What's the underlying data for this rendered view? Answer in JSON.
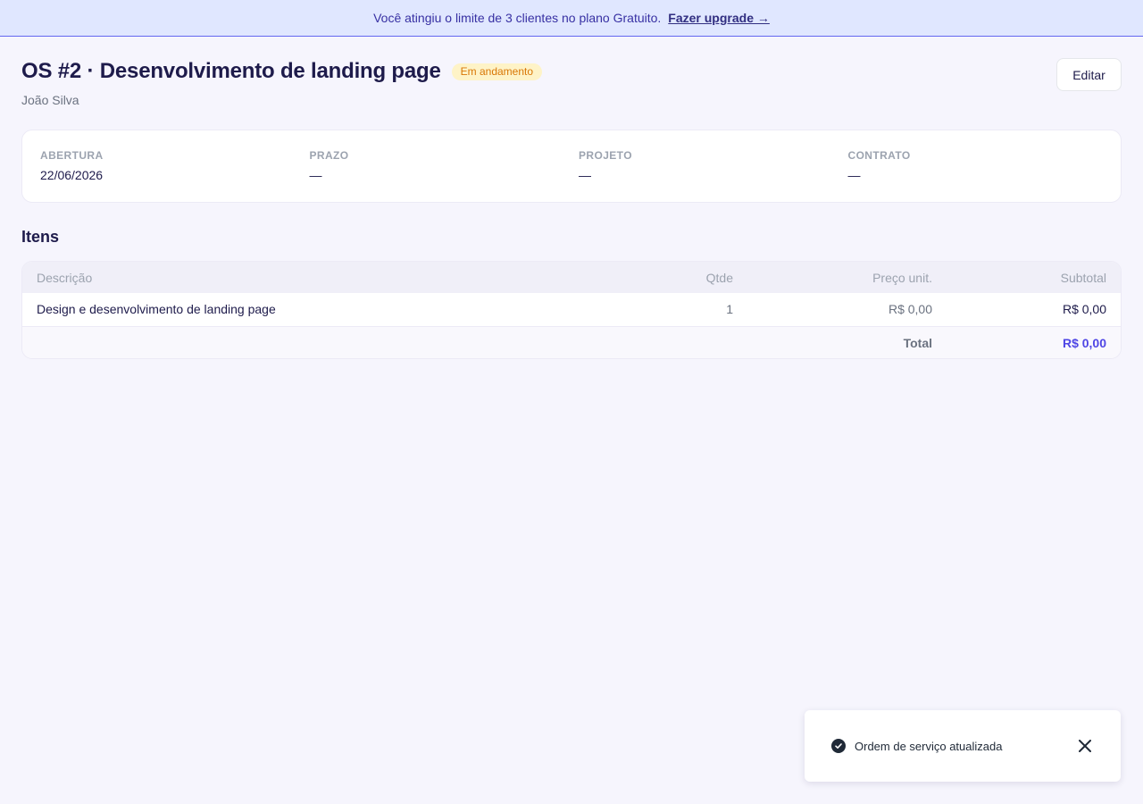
{
  "banner": {
    "message": "Você atingiu o limite de 3 clientes no plano Gratuito.",
    "link_label": "Fazer upgrade →"
  },
  "header": {
    "title": "OS #2 · Desenvolvimento de landing page",
    "status_badge": "Em andamento",
    "client_name": "João Silva",
    "edit_label": "Editar"
  },
  "meta": {
    "fields": [
      {
        "label": "ABERTURA",
        "value": "22/06/2026"
      },
      {
        "label": "PRAZO",
        "value": "—"
      },
      {
        "label": "PROJETO",
        "value": "—"
      },
      {
        "label": "CONTRATO",
        "value": "—"
      }
    ]
  },
  "items": {
    "section_title": "Itens",
    "columns": [
      "Descrição",
      "Qtde",
      "Preço unit.",
      "Subtotal"
    ],
    "rows": [
      {
        "description": "Design e desenvolvimento de landing page",
        "qty": "1",
        "unit_price": "R$ 0,00",
        "subtotal": "R$ 0,00"
      }
    ],
    "total_label": "Total",
    "total_value": "R$ 0,00"
  },
  "toast": {
    "message": "Ordem de serviço atualizada",
    "icon": "check-circle-icon",
    "close_icon": "close-icon"
  },
  "colors": {
    "accent": "#4f46e5",
    "banner_bg": "#e0e7ff",
    "badge_bg": "#fef3c7",
    "badge_text": "#d97706"
  }
}
